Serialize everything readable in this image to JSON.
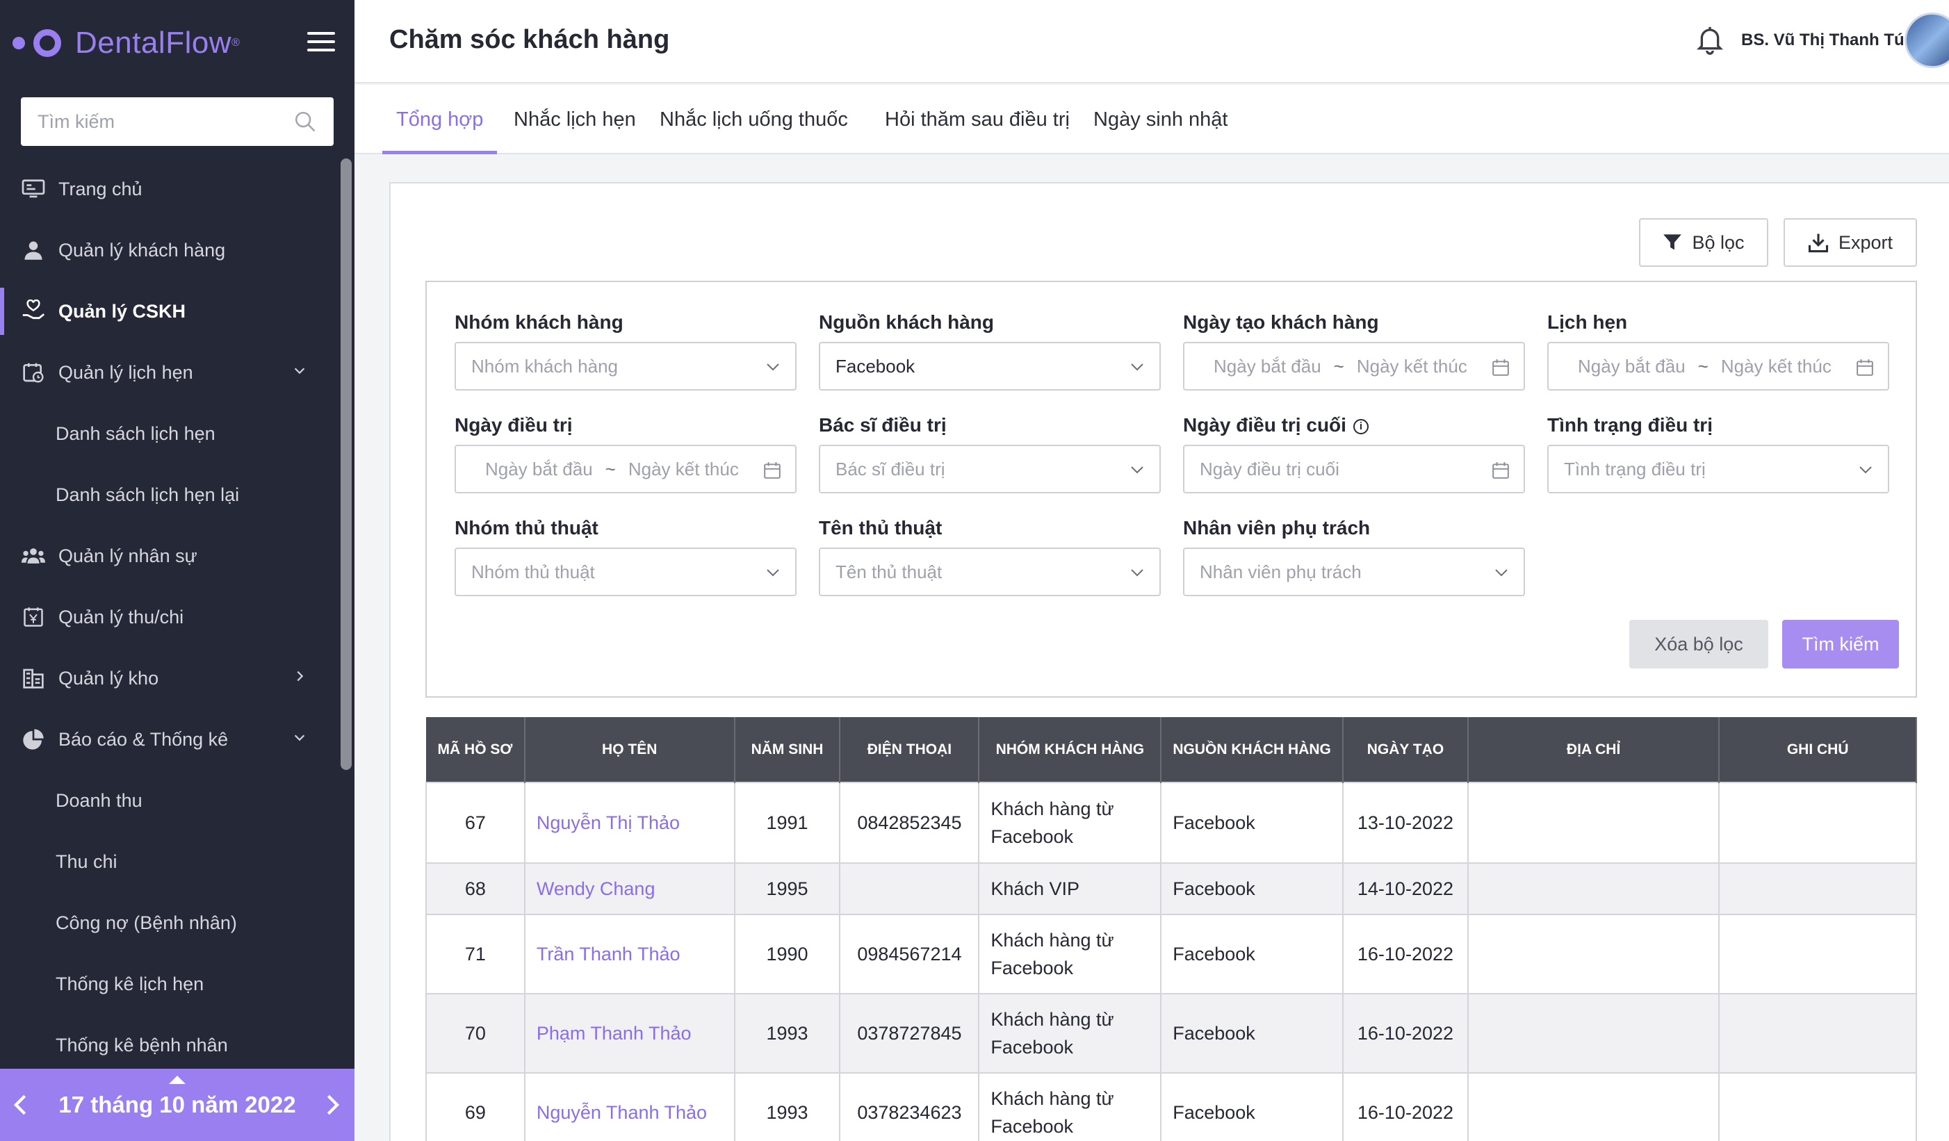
{
  "brand": {
    "name": "DentalFlow",
    "reg": "®"
  },
  "sidebar": {
    "search_placeholder": "Tìm kiếm",
    "items": [
      {
        "label": "Trang chủ",
        "icon": "monitor-icon"
      },
      {
        "label": "Quản lý khách hàng",
        "icon": "user-icon"
      },
      {
        "label": "Quản lý CSKH",
        "icon": "hand-care-icon",
        "active": true
      },
      {
        "label": "Quản lý lịch hẹn",
        "icon": "calendar-clock-icon",
        "chevron": "down"
      },
      {
        "label": "Danh sách lịch hẹn",
        "sub": true
      },
      {
        "label": "Danh sách lịch hẹn lại",
        "sub": true
      },
      {
        "label": "Quản lý nhân sự",
        "icon": "people-icon"
      },
      {
        "label": "Quản lý thu/chi",
        "icon": "money-icon"
      },
      {
        "label": "Quản lý kho",
        "icon": "warehouse-icon",
        "chevron": "right"
      },
      {
        "label": "Báo cáo & Thống kê",
        "icon": "pie-chart-icon",
        "chevron": "down"
      },
      {
        "label": "Doanh thu",
        "sub": true
      },
      {
        "label": "Thu chi",
        "sub": true
      },
      {
        "label": "Công nợ (Bệnh nhân)",
        "sub": true
      },
      {
        "label": "Thống kê lịch hẹn",
        "sub": true
      },
      {
        "label": "Thống kê bệnh nhân",
        "sub": true
      }
    ],
    "date_label": "17 tháng 10 năm 2022"
  },
  "header": {
    "title": "Chăm sóc khách hàng",
    "user_name": "BS. Vũ Thị Thanh Tú"
  },
  "tabs": [
    {
      "label": "Tổng hợp",
      "active": true
    },
    {
      "label": "Nhắc lịch hẹn"
    },
    {
      "label": "Nhắc lịch uống thuốc"
    },
    {
      "label": "Hỏi thăm sau điều trị"
    },
    {
      "label": "Ngày sinh nhật"
    }
  ],
  "toolbar": {
    "filter_label": "Bộ lọc",
    "export_label": "Export"
  },
  "filters": {
    "customer_group": {
      "label": "Nhóm khách hàng",
      "placeholder": "Nhóm khách hàng"
    },
    "customer_source": {
      "label": "Nguồn khách hàng",
      "value": "Facebook"
    },
    "created_date": {
      "label": "Ngày tạo khách hàng",
      "start": "Ngày bắt đầu",
      "end": "Ngày kết thúc"
    },
    "appointment": {
      "label": "Lịch hẹn",
      "start": "Ngày bắt đầu",
      "end": "Ngày kết thúc"
    },
    "treatment_date": {
      "label": "Ngày điều trị",
      "start": "Ngày bắt đầu",
      "end": "Ngày kết thúc"
    },
    "doctor": {
      "label": "Bác sĩ điều trị",
      "placeholder": "Bác sĩ điều trị"
    },
    "last_treatment": {
      "label": "Ngày điều trị cuối",
      "placeholder": "Ngày điều trị cuối"
    },
    "treatment_status": {
      "label": "Tình trạng điều trị",
      "placeholder": "Tình trạng điều trị"
    },
    "procedure_group": {
      "label": "Nhóm thủ thuật",
      "placeholder": "Nhóm thủ thuật"
    },
    "procedure_name": {
      "label": "Tên thủ thuật",
      "placeholder": "Tên thủ thuật"
    },
    "staff": {
      "label": "Nhân viên phụ trách",
      "placeholder": "Nhân viên phụ trách"
    },
    "separator": "~",
    "clear_label": "Xóa bộ lọc",
    "search_label": "Tìm kiếm"
  },
  "table": {
    "columns": [
      "MÃ HỒ SƠ",
      "HỌ TÊN",
      "NĂM SINH",
      "ĐIỆN THOẠI",
      "NHÓM KHÁCH HÀNG",
      "NGUỒN KHÁCH HÀNG",
      "NGÀY TẠO",
      "ĐỊA CHỈ",
      "GHI CHÚ"
    ],
    "rows": [
      {
        "id": "67",
        "name": "Nguyễn Thị Thảo",
        "birth": "1991",
        "phone": "0842852345",
        "group": "Khách hàng từ Facebook",
        "source": "Facebook",
        "created": "13-10-2022",
        "address": "",
        "note": ""
      },
      {
        "id": "68",
        "name": "Wendy Chang",
        "birth": "1995",
        "phone": "",
        "group": "Khách VIP",
        "source": "Facebook",
        "created": "14-10-2022",
        "address": "",
        "note": ""
      },
      {
        "id": "71",
        "name": "Trần Thanh Thảo",
        "birth": "1990",
        "phone": "0984567214",
        "group": "Khách hàng từ Facebook",
        "source": "Facebook",
        "created": "16-10-2022",
        "address": "",
        "note": ""
      },
      {
        "id": "70",
        "name": "Phạm Thanh Thảo",
        "birth": "1993",
        "phone": "0378727845",
        "group": "Khách hàng từ Facebook",
        "source": "Facebook",
        "created": "16-10-2022",
        "address": "",
        "note": ""
      },
      {
        "id": "69",
        "name": "Nguyễn Thanh Thảo",
        "birth": "1993",
        "phone": "0378234623",
        "group": "Khách hàng từ Facebook",
        "source": "Facebook",
        "created": "16-10-2022",
        "address": "",
        "note": ""
      }
    ]
  },
  "colors": {
    "accent": "#9a7ff0",
    "sidebar_bg": "#252837",
    "table_header": "#4a4c55"
  }
}
